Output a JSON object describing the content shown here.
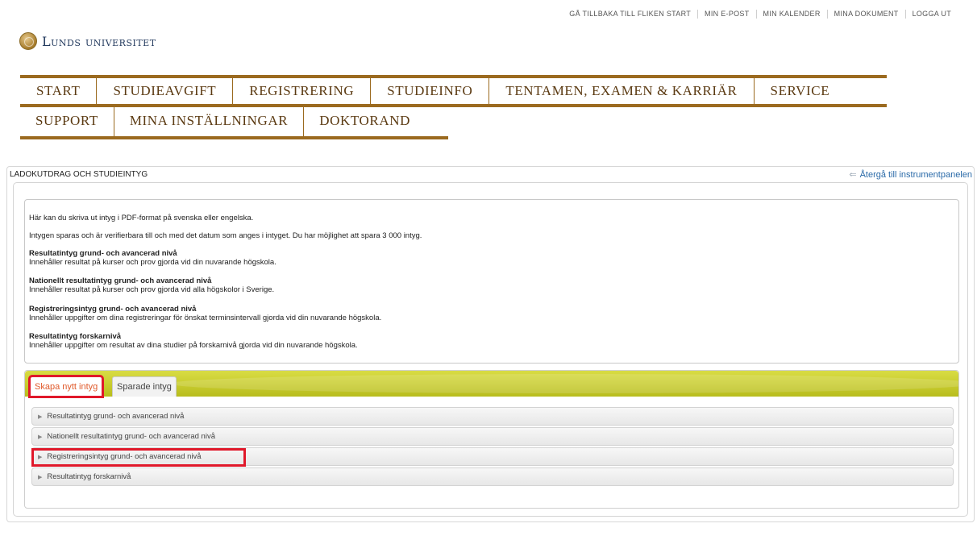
{
  "top_links": [
    "GÅ TILLBAKA TILL FLIKEN START",
    "MIN E-POST",
    "MIN KALENDER",
    "MINA DOKUMENT",
    "LOGGA UT"
  ],
  "logo": {
    "text": "Lunds universitet",
    "icon": "university-seal-icon"
  },
  "nav": {
    "row1": [
      "START",
      "STUDIEAVGIFT",
      "REGISTRERING",
      "STUDIEINFO",
      "TENTAMEN, EXAMEN & KARRIÄR",
      "SERVICE"
    ],
    "row2": [
      "SUPPORT",
      "MINA INSTÄLLNINGAR",
      "DOKTORAND"
    ]
  },
  "panel": {
    "title": "LADOKUTDRAG OCH STUDIEINTYG",
    "back_link": "Återgå till instrumentpanelen",
    "back_icon": "arrow-left-icon"
  },
  "info": {
    "intro1": "Här kan du skriva ut intyg i PDF-format på svenska eller engelska.",
    "intro2": "Intygen sparas och är verifierbara till och med det datum som anges i intyget. Du har möjlighet att spara 3 000 intyg.",
    "sections": [
      {
        "heading": "Resultatintyg grund- och avancerad nivå",
        "desc": "Innehåller resultat på kurser och prov gjorda vid din nuvarande högskola."
      },
      {
        "heading": "Nationellt resultatintyg grund- och avancerad nivå",
        "desc": "Innehåller resultat på kurser och prov gjorda vid alla högskolor i Sverige."
      },
      {
        "heading": "Registreringsintyg grund- och avancerad nivå",
        "desc": "Innehåller uppgifter om dina registreringar för önskat terminsintervall gjorda vid din nuvarande högskola."
      },
      {
        "heading": "Resultatintyg forskarnivå",
        "desc": "Innehåller uppgifter om resultat av dina studier på forskarnivå gjorda vid din nuvarande högskola."
      }
    ]
  },
  "tabs": [
    "Skapa nytt intyg",
    "Sparade intyg"
  ],
  "accordion": [
    "Resultatintyg grund- och avancerad nivå",
    "Nationellt resultatintyg grund- och avancerad nivå",
    "Registreringsintyg grund- och avancerad nivå",
    "Resultatintyg forskarnivå"
  ],
  "colors": {
    "nav_border": "#9b6a1f",
    "highlight": "#e0182a",
    "tabbar": "#c6ca2a",
    "link": "#2a6aa8"
  }
}
